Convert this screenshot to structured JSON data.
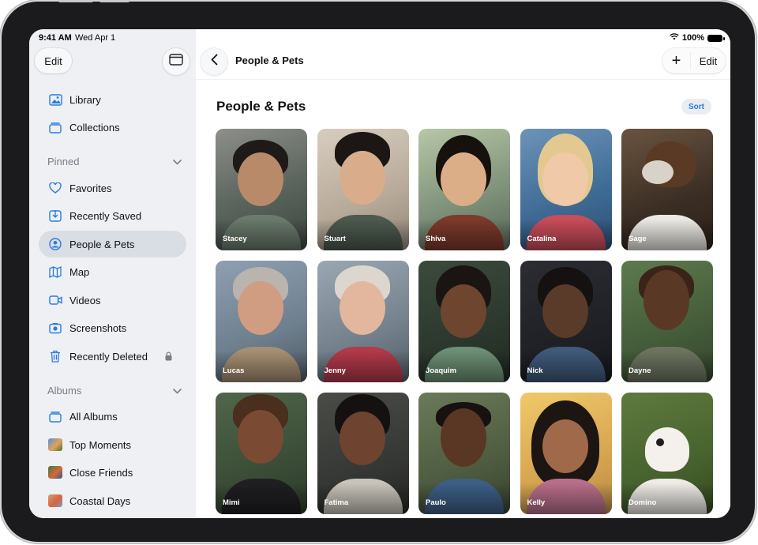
{
  "status_bar": {
    "time": "9:41 AM",
    "date": "Wed Apr 1",
    "battery": "100%"
  },
  "sidebar": {
    "edit_label": "Edit",
    "items_top": [
      {
        "label": "Library",
        "icon": "photo-library-icon"
      },
      {
        "label": "Collections",
        "icon": "collections-icon"
      }
    ],
    "pinned_header": "Pinned",
    "pinned_items": [
      {
        "label": "Favorites",
        "icon": "heart-icon"
      },
      {
        "label": "Recently Saved",
        "icon": "download-icon"
      },
      {
        "label": "People & Pets",
        "icon": "person-circle-icon",
        "active": true
      },
      {
        "label": "Map",
        "icon": "map-icon"
      },
      {
        "label": "Videos",
        "icon": "video-icon"
      },
      {
        "label": "Screenshots",
        "icon": "screenshot-icon"
      },
      {
        "label": "Recently Deleted",
        "icon": "trash-icon",
        "locked": true
      }
    ],
    "albums_header": "Albums",
    "album_items": [
      {
        "label": "All Albums",
        "icon": "albums-icon"
      },
      {
        "label": "Top Moments",
        "icon": "album-thumbnail"
      },
      {
        "label": "Close Friends",
        "icon": "album-thumbnail"
      },
      {
        "label": "Coastal Days",
        "icon": "album-thumbnail"
      }
    ]
  },
  "topbar": {
    "title": "People & Pets",
    "edit_label": "Edit",
    "add_icon": "plus-icon"
  },
  "page": {
    "title": "People & Pets",
    "sort_label": "Sort"
  },
  "people": [
    {
      "name": "Stacey"
    },
    {
      "name": "Stuart"
    },
    {
      "name": "Shiva"
    },
    {
      "name": "Catalina"
    },
    {
      "name": "Sage"
    },
    {
      "name": "Lucas"
    },
    {
      "name": "Jenny"
    },
    {
      "name": "Joaquim"
    },
    {
      "name": "Nick"
    },
    {
      "name": "Dayne"
    },
    {
      "name": "Mimi"
    },
    {
      "name": "Fatima"
    },
    {
      "name": "Paulo"
    },
    {
      "name": "Kelly"
    },
    {
      "name": "Domino"
    }
  ],
  "colors": {
    "accent": "#2a7ae2",
    "sidebar_bg": "#eef0f4",
    "active_bg": "#d9dde4"
  }
}
